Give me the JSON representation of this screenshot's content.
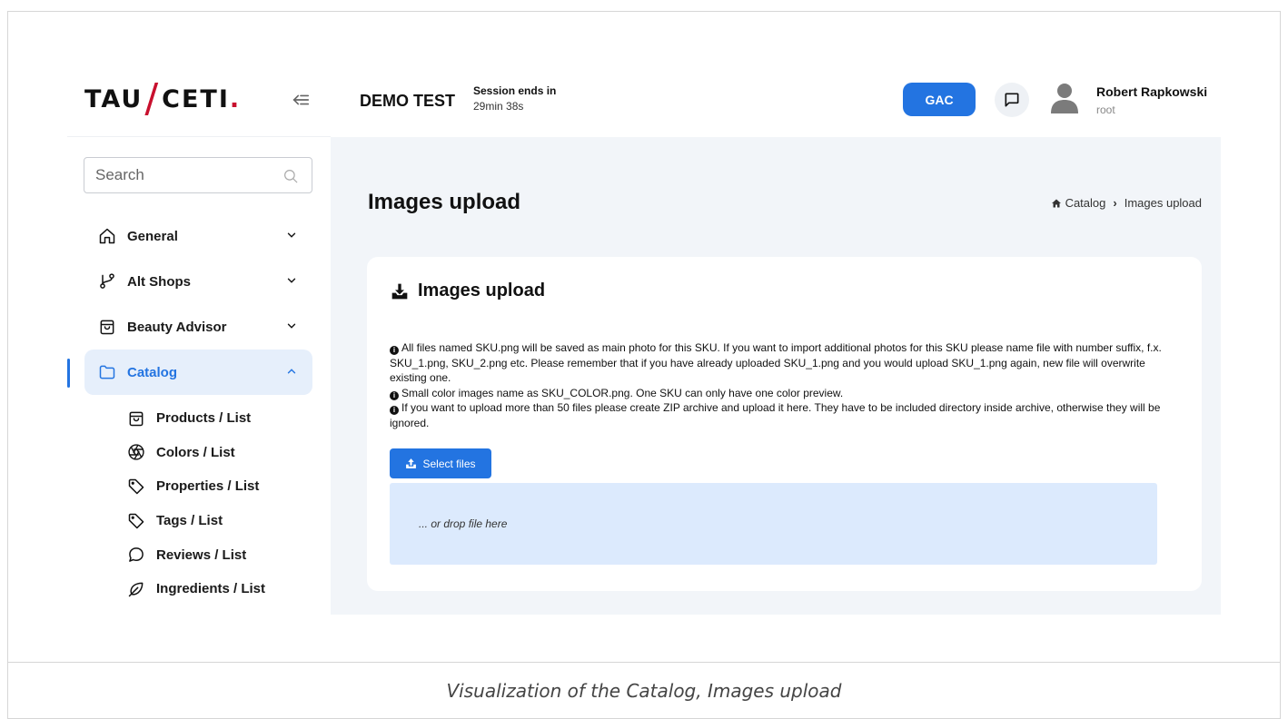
{
  "sidebar": {
    "logo": {
      "left": "TAU",
      "slash": "/",
      "right": "CETI",
      "dot": "."
    },
    "search_placeholder": "Search",
    "items": [
      {
        "label": "General",
        "icon": "home-icon"
      },
      {
        "label": "Alt Shops",
        "icon": "branch-icon"
      },
      {
        "label": "Beauty Advisor",
        "icon": "bag-icon"
      },
      {
        "label": "Catalog",
        "icon": "folder-icon",
        "active": true
      }
    ],
    "sub_items": [
      {
        "label": "Products / List",
        "icon": "bag-icon"
      },
      {
        "label": "Colors / List",
        "icon": "aperture-icon"
      },
      {
        "label": "Properties / List",
        "icon": "tag-icon"
      },
      {
        "label": "Tags / List",
        "icon": "tag-icon"
      },
      {
        "label": "Reviews / List",
        "icon": "chat-bubble-icon"
      },
      {
        "label": "Ingredients / List",
        "icon": "leaf-icon"
      }
    ]
  },
  "header": {
    "app_name": "DEMO TEST",
    "session_label": "Session ends in",
    "session_time": "29min 38s",
    "gac_label": "GAC",
    "user_name": "Robert Rapkowski",
    "user_role": "root"
  },
  "main": {
    "page_title": "Images upload",
    "breadcrumb": {
      "home": "Catalog",
      "separator": "›",
      "current": "Images upload"
    },
    "card": {
      "title": "Images upload",
      "info_1": "All files named SKU.png will be saved as main photo for this SKU. If you want to import additional photos for this SKU please name file with number suffix, f.x. SKU_1.png, SKU_2.png etc. Please remember that if you have already uploaded SKU_1.png and you would upload SKU_1.png again, new file will overwrite existing one.",
      "info_2": "Small color images name as SKU_COLOR.png. One SKU can only have one color preview.",
      "info_3": "If you want to upload more than 50 files please create ZIP archive and upload it here. They have to be included directory inside archive, otherwise they will be ignored.",
      "select_files_label": "Select files",
      "drop_text": "... or drop file here"
    }
  },
  "caption": "Visualization of the Catalog, Images upload",
  "colors": {
    "accent": "#2374e1",
    "logo_red": "#c8102e",
    "dropzone": "#dceafd",
    "content_bg": "#f2f5f9"
  }
}
